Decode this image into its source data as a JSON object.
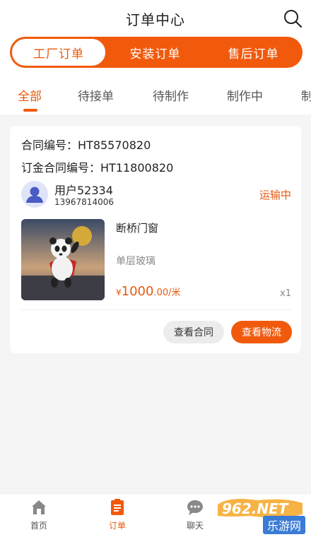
{
  "header": {
    "title": "订单中心",
    "search_icon": "search-icon"
  },
  "segments": [
    {
      "label": "工厂订单",
      "active": true
    },
    {
      "label": "安装订单",
      "active": false
    },
    {
      "label": "售后订单",
      "active": false
    }
  ],
  "tabs": [
    {
      "label": "全部",
      "active": true
    },
    {
      "label": "待接单",
      "active": false
    },
    {
      "label": "待制作",
      "active": false
    },
    {
      "label": "制作中",
      "active": false
    },
    {
      "label": "制",
      "active": false
    }
  ],
  "order": {
    "contract_label": "合同编号：",
    "contract_no": "HT85570820",
    "deposit_label": "订金合同编号：",
    "deposit_no": "HT11800820",
    "user_name": "用户52334",
    "user_phone": "13967814006",
    "status": "运输中",
    "product_name": "断桥门窗",
    "product_spec": "单层玻璃",
    "price_currency": "¥",
    "price_int": "1000",
    "price_dec": ".00",
    "price_unit": "/米",
    "quantity": "x1",
    "btn_contract": "查看合同",
    "btn_logistics": "查看物流"
  },
  "bottom_nav": [
    {
      "label": "首页",
      "icon": "home-icon",
      "active": false
    },
    {
      "label": "订单",
      "icon": "order-icon",
      "active": true
    },
    {
      "label": "聊天",
      "icon": "chat-icon",
      "active": false
    }
  ],
  "watermark": {
    "text": "乐游网",
    "logo": "962.NET"
  },
  "colors": {
    "accent": "#f15a0c",
    "accent_text": "#e8590c",
    "background": "#f5f5f5"
  }
}
